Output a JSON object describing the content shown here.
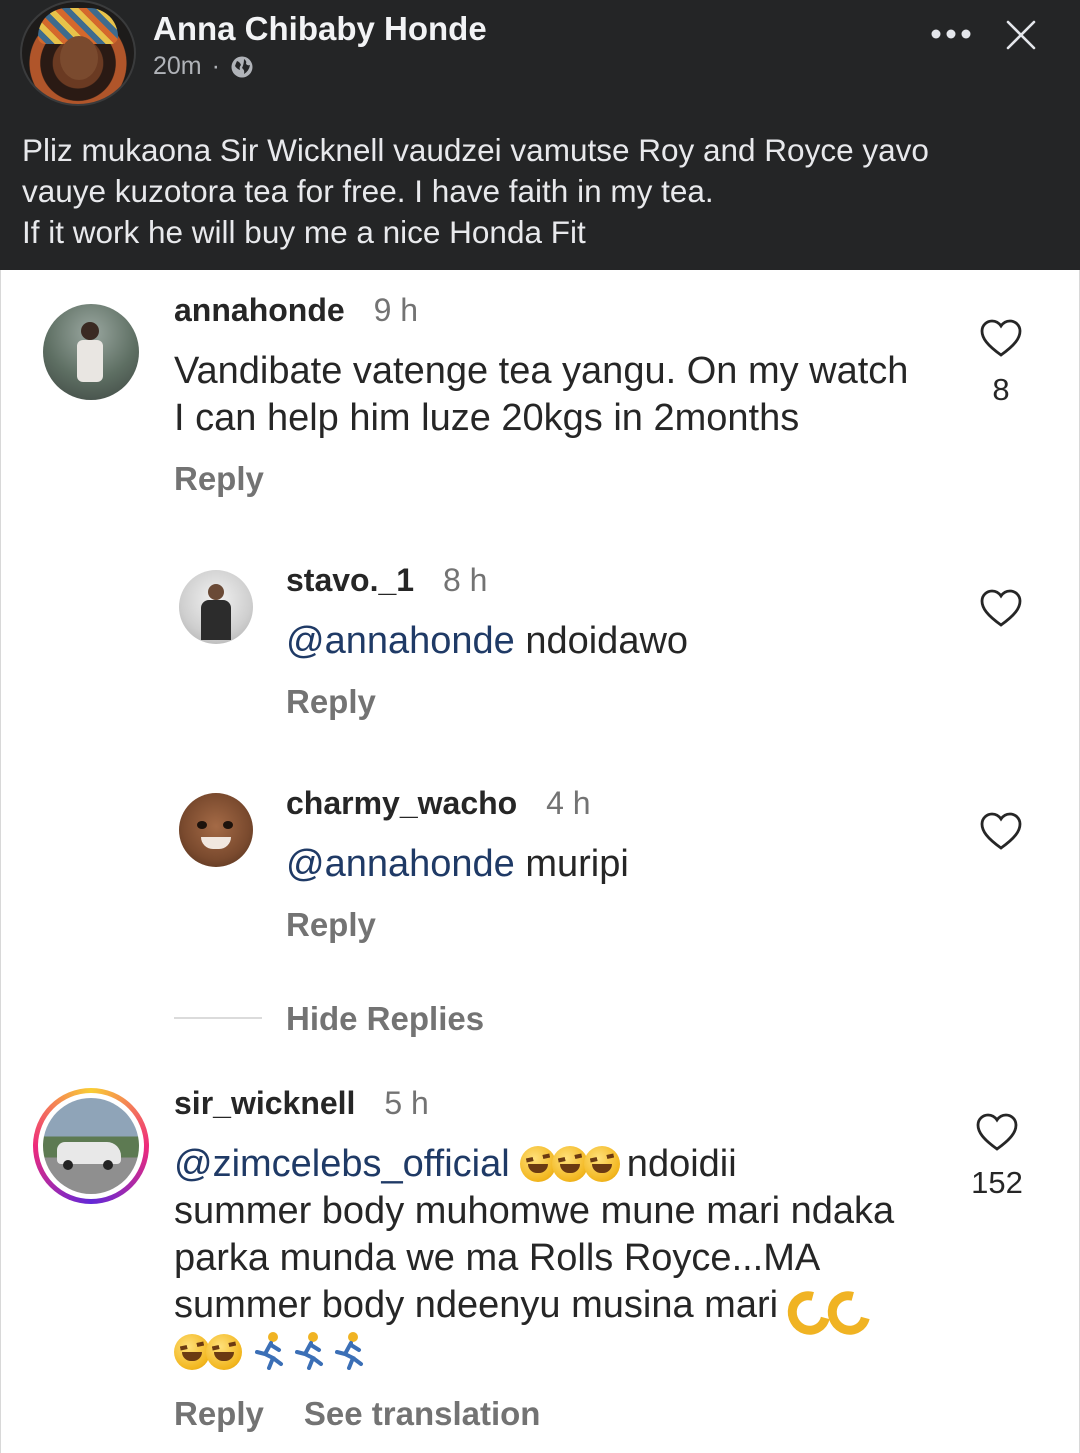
{
  "post": {
    "author_name": "Anna Chibaby Honde",
    "time": "20m",
    "separator": "·",
    "text_lines": [
      "Pliz mukaona Sir Wicknell vaudzei vamutse Roy and Royce yavo",
      "vauye kuzotora tea for free. I have faith in my tea.",
      "If it work he will buy me a  nice Honda Fit"
    ],
    "icons": [
      "globe-icon",
      "more-icon",
      "close-icon"
    ]
  },
  "comments": [
    {
      "username": "annahonde",
      "time": "9 h",
      "lines": [
        "Vandibate vatenge tea yangu. On my watch",
        "I can help him luze 20kgs in 2months"
      ],
      "likes": "8",
      "reply_label": "Reply"
    },
    {
      "username": "stavo._1",
      "time": "8 h",
      "mention": "@annahonde",
      "text": " ndoidawo",
      "reply_label": "Reply"
    },
    {
      "username": "charmy_wacho",
      "time": "4 h",
      "mention": "@annahonde",
      "text": " muripi",
      "reply_label": "Reply"
    },
    {
      "username": "sir_wicknell",
      "time": "5 h",
      "mention": "@zimcelebs_official",
      "line1_tail": " ndoidii",
      "line2": "summer body muhomwe mune mari ndaka",
      "line3": "parka munda we ma Rolls Royce...MA",
      "line4": "summer body ndeenyu musina mari",
      "likes": "152",
      "reply_label": "Reply",
      "translate_label": "See translation"
    }
  ],
  "hide_replies_label": "Hide Replies",
  "colors": {
    "post_bg": "#242526",
    "mention": "#1f3a66",
    "muted": "#737373",
    "story_ring": "#e1306c"
  }
}
